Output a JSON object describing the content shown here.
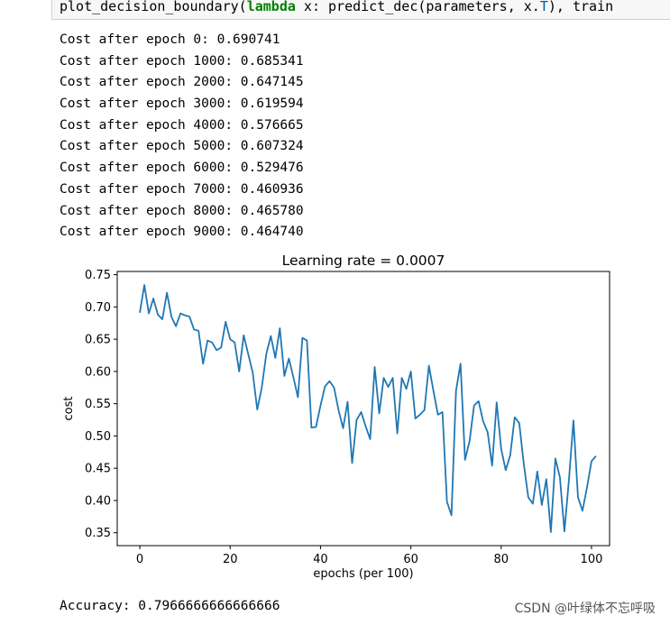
{
  "code_cell": {
    "fn": "plot_decision_boundary(",
    "kw": "lambda",
    "mid": " x: predict_dec(parameters, x.",
    "attr": "T",
    "tail": "), train"
  },
  "log_lines": [
    "Cost after epoch 0: 0.690741",
    "Cost after epoch 1000: 0.685341",
    "Cost after epoch 2000: 0.647145",
    "Cost after epoch 3000: 0.619594",
    "Cost after epoch 4000: 0.576665",
    "Cost after epoch 5000: 0.607324",
    "Cost after epoch 6000: 0.529476",
    "Cost after epoch 7000: 0.460936",
    "Cost after epoch 8000: 0.465780",
    "Cost after epoch 9000: 0.464740"
  ],
  "chart_data": {
    "type": "line",
    "title": "Learning rate = 0.0007",
    "xlabel": "epochs (per 100)",
    "ylabel": "cost",
    "xlim": [
      -5,
      104
    ],
    "ylim": [
      0.33,
      0.755
    ],
    "xticks": [
      0,
      20,
      40,
      60,
      80,
      100
    ],
    "yticks": [
      0.35,
      0.4,
      0.45,
      0.5,
      0.55,
      0.6,
      0.65,
      0.7,
      0.75
    ],
    "grid": false,
    "color": "#1f77b4",
    "y": [
      0.691,
      0.734,
      0.69,
      0.713,
      0.688,
      0.681,
      0.722,
      0.685,
      0.67,
      0.69,
      0.687,
      0.685,
      0.665,
      0.663,
      0.612,
      0.648,
      0.645,
      0.633,
      0.637,
      0.677,
      0.65,
      0.645,
      0.6,
      0.656,
      0.627,
      0.598,
      0.541,
      0.575,
      0.627,
      0.655,
      0.621,
      0.667,
      0.593,
      0.62,
      0.591,
      0.56,
      0.652,
      0.648,
      0.513,
      0.514,
      0.547,
      0.577,
      0.585,
      0.575,
      0.54,
      0.512,
      0.553,
      0.458,
      0.525,
      0.537,
      0.515,
      0.495,
      0.607,
      0.535,
      0.59,
      0.576,
      0.59,
      0.504,
      0.59,
      0.573,
      0.6,
      0.527,
      0.533,
      0.54,
      0.609,
      0.57,
      0.533,
      0.537,
      0.398,
      0.377,
      0.57,
      0.612,
      0.463,
      0.492,
      0.547,
      0.554,
      0.523,
      0.506,
      0.454,
      0.552,
      0.48,
      0.447,
      0.47,
      0.529,
      0.52,
      0.457,
      0.405,
      0.395,
      0.445,
      0.393,
      0.433,
      0.351,
      0.465,
      0.436,
      0.352,
      0.432,
      0.524,
      0.405,
      0.384,
      0.42,
      0.461,
      0.469
    ]
  },
  "accuracy": "Accuracy: 0.7966666666666666",
  "watermark": "CSDN @叶绿体不忘呼吸"
}
